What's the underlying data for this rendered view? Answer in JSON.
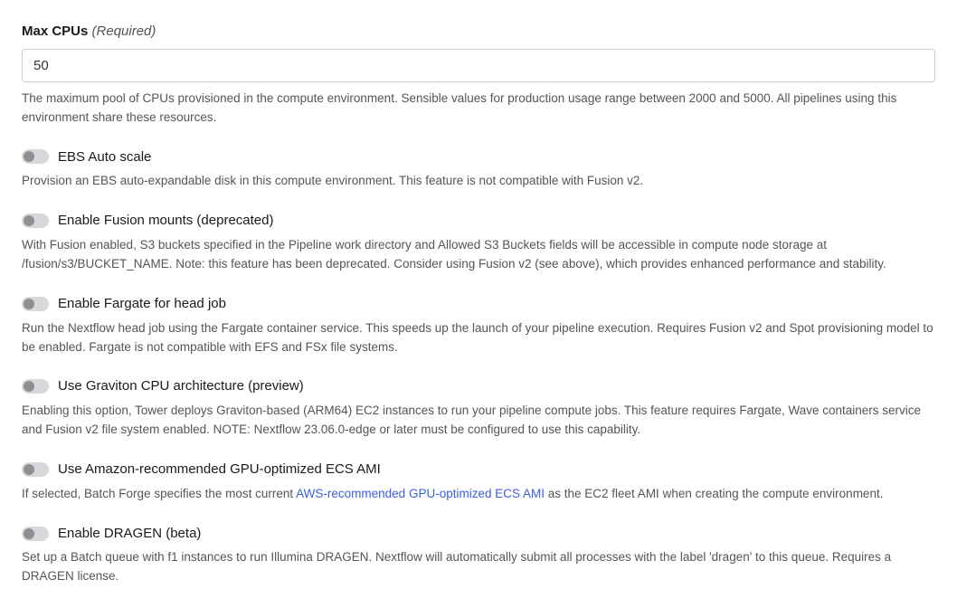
{
  "maxCpus": {
    "label": "Max CPUs",
    "requiredTag": "(Required)",
    "value": "50",
    "help": "The maximum pool of CPUs provisioned in the compute environment. Sensible values for production usage range between 2000 and 5000. All pipelines using this environment share these resources."
  },
  "toggles": {
    "ebsAutoScale": {
      "label": "EBS Auto scale",
      "help": "Provision an EBS auto-expandable disk in this compute environment. This feature is not compatible with Fusion v2.",
      "checked": false
    },
    "fusionMounts": {
      "label": "Enable Fusion mounts (deprecated)",
      "help": "With Fusion enabled, S3 buckets specified in the Pipeline work directory and Allowed S3 Buckets fields will be accessible in compute node storage at /fusion/s3/BUCKET_NAME. Note: this feature has been deprecated. Consider using Fusion v2 (see above), which provides enhanced performance and stability.",
      "checked": false
    },
    "fargateHead": {
      "label": "Enable Fargate for head job",
      "help": "Run the Nextflow head job using the Fargate container service. This speeds up the launch of your pipeline execution. Requires Fusion v2 and Spot provisioning model to be enabled. Fargate is not compatible with EFS and FSx file systems.",
      "checked": false
    },
    "graviton": {
      "label": "Use Graviton CPU architecture (preview)",
      "help": "Enabling this option, Tower deploys Graviton-based (ARM64) EC2 instances to run your pipeline compute jobs. This feature requires Fargate, Wave containers service and Fusion v2 file system enabled. NOTE: Nextflow 23.06.0-edge or later must be configured to use this capability.",
      "checked": false
    },
    "gpuAmi": {
      "label": "Use Amazon-recommended GPU-optimized ECS AMI",
      "helpPrefix": "If selected, Batch Forge specifies the most current ",
      "linkText": "AWS-recommended GPU-optimized ECS AMI",
      "helpSuffix": " as the EC2 fleet AMI when creating the compute environment.",
      "checked": false
    },
    "dragen": {
      "label": "Enable DRAGEN (beta)",
      "help": "Set up a Batch queue with f1 instances to run Illumina DRAGEN. Nextflow will automatically submit all processes with the label 'dragen' to this queue. Requires a DRAGEN license.",
      "checked": false
    }
  }
}
